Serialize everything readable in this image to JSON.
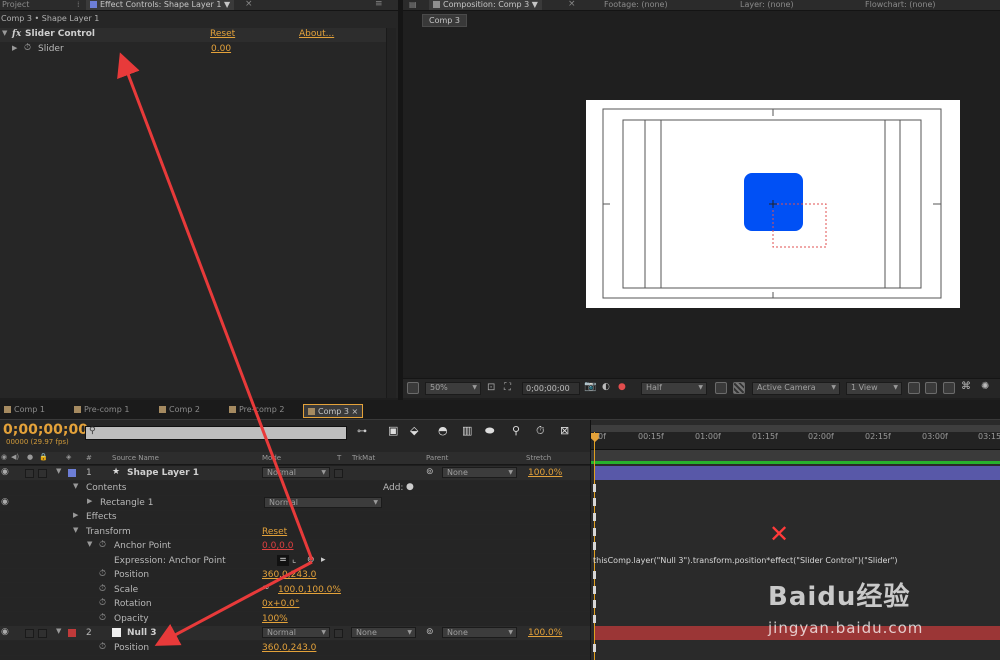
{
  "colors": {
    "orange": "#e4a23a",
    "comp_blue_square": "#0050f5",
    "arrow_red": "#e83a3a",
    "timeline_layer1_bar": "#5858a8",
    "timeline_layer2_bar": "#9b3636",
    "green_work_area": "#27b22c"
  },
  "top_tabs": {
    "project": "Project",
    "effect_controls": "Effect Controls: Shape Layer 1",
    "composition": "Composition: Comp 3",
    "footage": "Footage: (none)",
    "layer": "Layer: (none)",
    "flowchart": "Flowchart: (none)"
  },
  "effect_controls": {
    "breadcrumb": "Comp 3 • Shape Layer 1",
    "fx_label": "fx",
    "effect_name": "Slider Control",
    "reset": "Reset",
    "about": "About...",
    "param_name": "Slider",
    "param_value": "0.00"
  },
  "composition": {
    "comp_tab": "Comp 3",
    "zoom": "50%",
    "timecode": "0;00;00;00",
    "resolution": "Half",
    "camera": "Active Camera",
    "views": "1 View"
  },
  "timeline_tabs": [
    "Comp 1",
    "Pre-comp 1",
    "Comp 2",
    "Pre-comp 2",
    "Comp 3"
  ],
  "timeline": {
    "current_time": "0;00;00;00",
    "fps": "00000 (29.97 fps)",
    "search_placeholder": "",
    "columns": {
      "num": "#",
      "source_name": "Source Name",
      "mode": "Mode",
      "t": "T",
      "trkmat": "TrkMat",
      "parent": "Parent",
      "stretch": "Stretch"
    },
    "ruler": [
      "0f",
      "00:15f",
      "01:00f",
      "01:15f",
      "02:00f",
      "02:15f",
      "03:00f",
      "03:15"
    ],
    "rows": {
      "layer1_num": "1",
      "layer1_name": "Shape Layer 1",
      "layer1_mode": "Normal",
      "layer1_parent": "None",
      "layer1_stretch": "100.0%",
      "contents": "Contents",
      "add": "Add:",
      "rectangle": "Rectangle 1",
      "rectangle_mode": "Normal",
      "effects": "Effects",
      "transform": "Transform",
      "transform_reset": "Reset",
      "anchor_point": "Anchor Point",
      "anchor_point_value": "0.0,0.0",
      "expression_label": "Expression: Anchor Point",
      "position": "Position",
      "position_value": "360.0,243.0",
      "scale": "Scale",
      "scale_value": "100.0,100.0%",
      "rotation": "Rotation",
      "rotation_value": "0x+0.0°",
      "opacity": "Opacity",
      "opacity_value": "100%",
      "layer2_num": "2",
      "layer2_name": "Null 3",
      "layer2_mode": "Normal",
      "layer2_trkmat": "None",
      "layer2_parent": "None",
      "layer2_stretch": "100.0%",
      "layer2_position": "Position",
      "layer2_position_value": "360.0,243.0"
    },
    "expression_text": "thisComp.layer(\"Null 3\").transform.position*effect(\"Slider Control\")(\"Slider\")"
  },
  "watermark": {
    "brand": "Baidu经验",
    "url": "jingyan.baidu.com"
  }
}
